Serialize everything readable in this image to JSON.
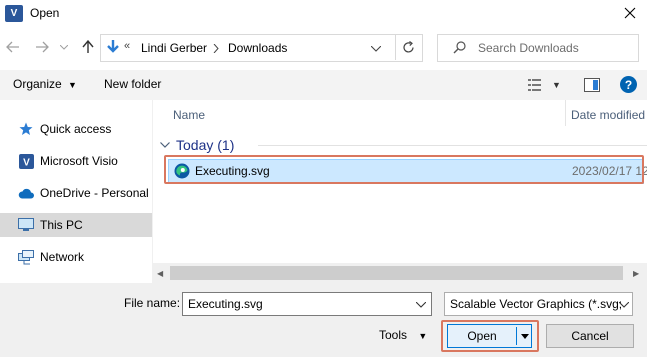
{
  "window": {
    "title": "Open",
    "app_icon": "V"
  },
  "address": {
    "overflow": "«",
    "crumbs": [
      "Lindi Gerber",
      "Downloads"
    ]
  },
  "search": {
    "placeholder": "Search Downloads"
  },
  "toolbar": {
    "organize": "Organize",
    "new_folder": "New folder"
  },
  "nav": [
    {
      "label": "Quick access",
      "icon": "star-icon"
    },
    {
      "label": "Microsoft Visio",
      "icon": "visio-icon"
    },
    {
      "label": "OneDrive - Personal",
      "icon": "cloud-icon"
    },
    {
      "label": "This PC",
      "icon": "pc-icon",
      "selected": true
    },
    {
      "label": "Network",
      "icon": "network-icon"
    }
  ],
  "list": {
    "col_name": "Name",
    "col_date": "Date modified",
    "group": "Today (1)",
    "files": [
      {
        "name": "Executing.svg",
        "date": "2023/02/17 12:"
      }
    ]
  },
  "bottom": {
    "file_name_label": "File name:",
    "file_name_value": "Executing.svg",
    "file_type": "Scalable Vector Graphics (*.svg;",
    "tools": "Tools",
    "open": "Open",
    "cancel": "Cancel"
  },
  "colors": {
    "accent": "#0078d7",
    "selection": "#cce8ff",
    "highlight_box": "#d9775f",
    "help": "#0063b1"
  }
}
